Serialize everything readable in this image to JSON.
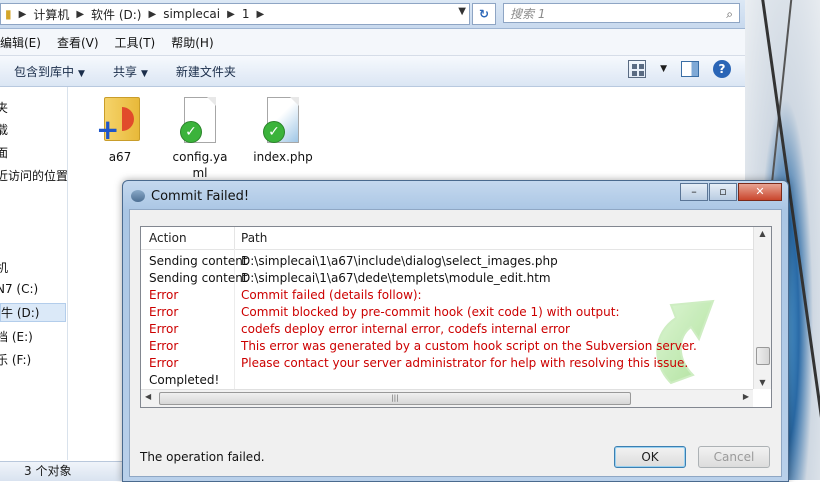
{
  "explorer": {
    "breadcrumbs": [
      "计算机",
      "软件 (D:)",
      "simplecai",
      "1"
    ],
    "search_placeholder": "搜索 1",
    "menu": [
      "编辑(E)",
      "查看(V)",
      "工具(T)",
      "帮助(H)"
    ],
    "toolbar": {
      "include_library": "包含到库中",
      "share": "共享",
      "new_folder": "新建文件夹"
    },
    "nav_items": [
      {
        "label": "夹"
      },
      {
        "label": "载"
      },
      {
        "label": "面"
      },
      {
        "label": "近访问的位置"
      },
      {
        "label": "机"
      },
      {
        "label": "N7 (C:)"
      },
      {
        "label": "牛 (D:)"
      },
      {
        "label": "档 (E:)"
      },
      {
        "label": "乐 (F:)"
      }
    ],
    "files": [
      {
        "name": "a67"
      },
      {
        "name": "config.yaml"
      },
      {
        "name": "index.php"
      }
    ],
    "status": "3 个对象"
  },
  "dialog": {
    "title": "Commit Failed!",
    "columns": {
      "action": "Action",
      "path": "Path"
    },
    "rows": [
      {
        "action": "Sending content",
        "path": "D:\\simplecai\\1\\a67\\include\\dialog\\select_images.php",
        "kind": "ok"
      },
      {
        "action": "Sending content",
        "path": "D:\\simplecai\\1\\a67\\dede\\templets\\module_edit.htm",
        "kind": "ok"
      },
      {
        "action": "Error",
        "path": "Commit failed (details follow):",
        "kind": "error"
      },
      {
        "action": "Error",
        "path": "Commit blocked by pre-commit hook (exit code 1) with output:",
        "kind": "error"
      },
      {
        "action": "Error",
        "path": "codefs deploy error internal error, codefs internal error",
        "kind": "error"
      },
      {
        "action": "Error",
        "path": "This error was generated by a custom hook script on the Subversion server.",
        "kind": "error"
      },
      {
        "action": "Error",
        "path": "Please contact your server administrator for help with resolving this issue.",
        "kind": "error"
      },
      {
        "action": "Completed!",
        "path": "",
        "kind": "ok"
      }
    ],
    "status_text": "The operation failed.",
    "ok_label": "OK",
    "cancel_label": "Cancel"
  },
  "colors": {
    "error": "#cc0000",
    "selection": "#dbe9f8"
  }
}
